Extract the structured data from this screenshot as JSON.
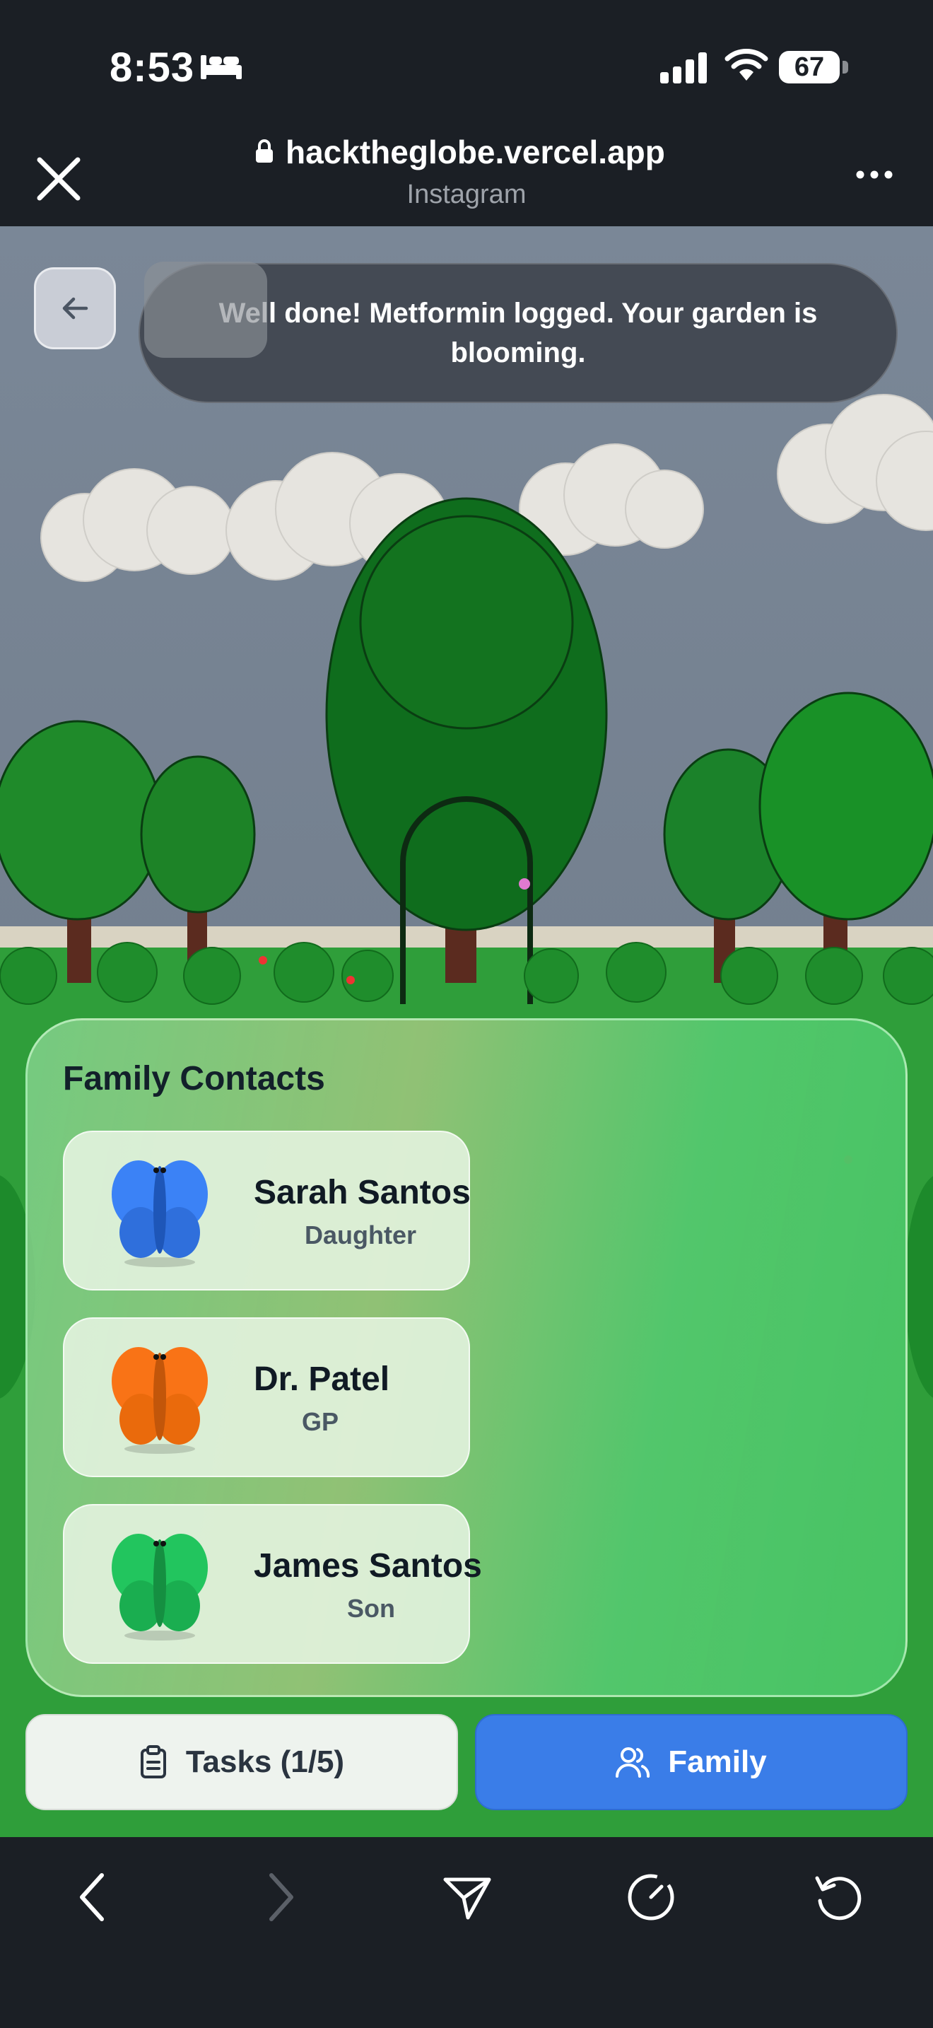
{
  "status_bar": {
    "time": "8:53",
    "battery": "67"
  },
  "browser": {
    "url": "hacktheglobe.vercel.app",
    "source": "Instagram"
  },
  "toast": {
    "message": "Well done! Metformin logged. Your garden is blooming."
  },
  "family_panel": {
    "title": "Family Contacts",
    "contacts": [
      {
        "name": "Sarah Santos",
        "role": "Daughter",
        "color": "#3b82f6"
      },
      {
        "name": "Dr. Patel",
        "role": "GP",
        "color": "#f97316"
      },
      {
        "name": "James Santos",
        "role": "Son",
        "color": "#22c55e"
      }
    ]
  },
  "tabs": {
    "tasks": "Tasks (1/5)",
    "family": "Family"
  },
  "colors": {
    "accent": "#3a7de8",
    "panel_green": "#4cc466"
  },
  "icons": [
    "bed-icon",
    "signal-icon",
    "wifi-icon",
    "close-icon",
    "lock-icon",
    "more-icon",
    "arrow-left-icon",
    "clipboard-icon",
    "users-icon",
    "chevron-left-icon",
    "chevron-right-icon",
    "send-icon",
    "compass-icon",
    "refresh-icon"
  ]
}
